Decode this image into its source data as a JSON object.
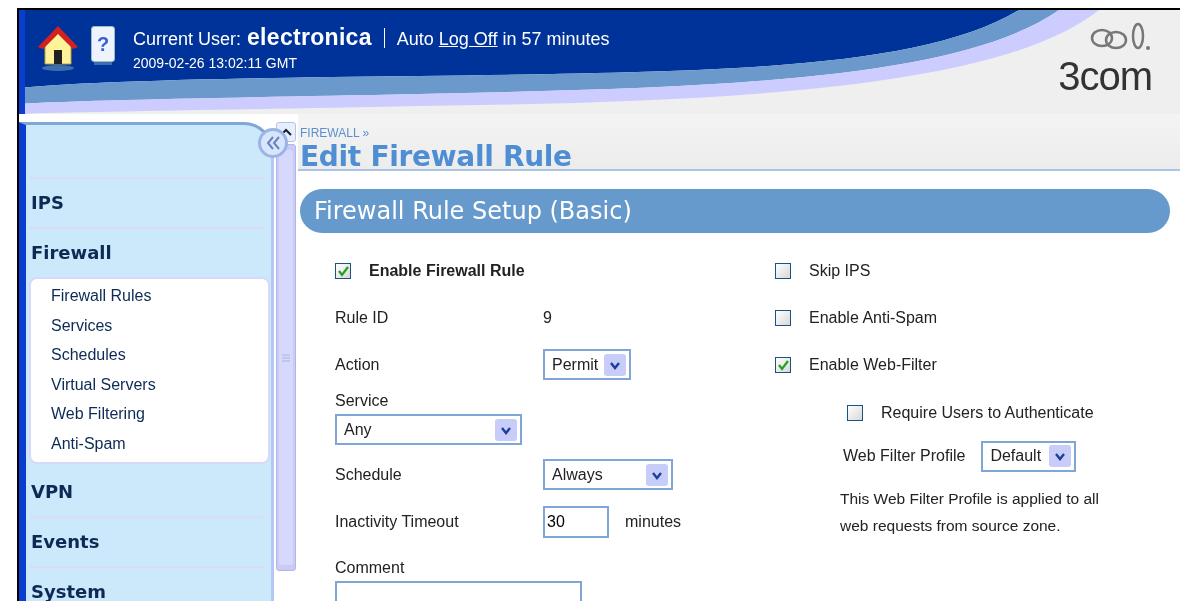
{
  "header": {
    "user_label": "Current User:",
    "user": "electronica",
    "logoff_before": "Auto",
    "logoff_link": "Log Off",
    "logoff_after": "in 57 minutes",
    "datetime": "2009-02-26 13:02:11 GMT",
    "brand": "3com",
    "help_glyph": "?"
  },
  "sidebar": {
    "items": [
      {
        "label": "IPS"
      },
      {
        "label": "Firewall",
        "children": [
          {
            "label": "Firewall Rules"
          },
          {
            "label": "Services"
          },
          {
            "label": "Schedules"
          },
          {
            "label": "Virtual Servers"
          },
          {
            "label": "Web Filtering"
          },
          {
            "label": "Anti-Spam"
          }
        ]
      },
      {
        "label": "VPN"
      },
      {
        "label": "Events"
      },
      {
        "label": "System"
      }
    ]
  },
  "breadcrumb": "FIREWALL »",
  "page_title": "Edit Firewall Rule",
  "section_title": "Firewall Rule Setup (Basic)",
  "form": {
    "left": [
      {
        "kind": "master_checkbox",
        "label": "Enable Firewall Rule",
        "checked": true
      },
      {
        "kind": "static",
        "label": "Rule ID",
        "value": "9"
      },
      {
        "kind": "select",
        "label": "Action",
        "value": "Permit"
      },
      {
        "kind": "select_below",
        "label": "Service",
        "value": "Any"
      },
      {
        "kind": "select",
        "label": "Schedule",
        "value": "Always"
      },
      {
        "kind": "number",
        "label": "Inactivity Timeout",
        "value": "30",
        "unit": "minutes"
      },
      {
        "kind": "textarea",
        "label": "Comment"
      }
    ],
    "right": [
      {
        "kind": "checkbox",
        "label": "Skip IPS",
        "checked": false
      },
      {
        "kind": "checkbox",
        "label": "Enable Anti-Spam",
        "checked": false
      },
      {
        "kind": "checkbox",
        "label": "Enable Web-Filter",
        "checked": true,
        "children": [
          {
            "kind": "checkbox",
            "label": "Require Users to Authenticate",
            "checked": false
          },
          {
            "kind": "select",
            "label": "Web Filter Profile",
            "value": "Default"
          },
          {
            "kind": "note",
            "text": "This Web Filter Profile is applied to all web requests from source zone."
          }
        ]
      }
    ]
  }
}
